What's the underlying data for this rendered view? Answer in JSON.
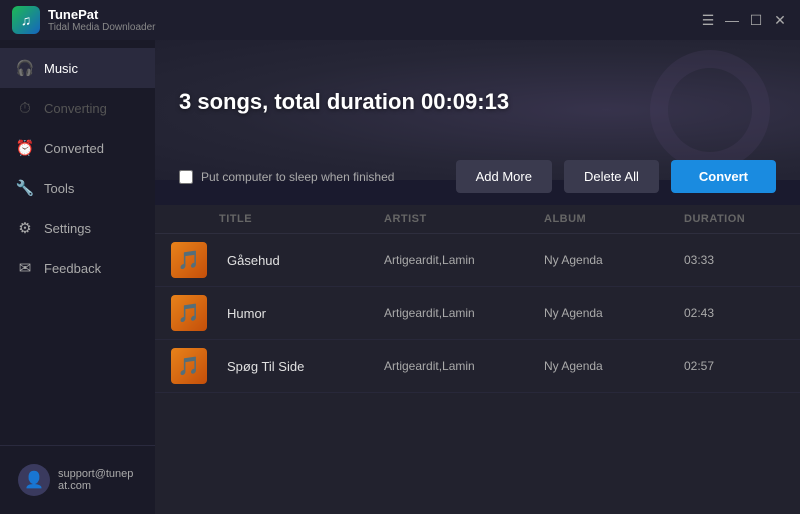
{
  "app": {
    "name": "TunePat",
    "subtitle": "Tidal Media Downloader",
    "logo_icon": "♫"
  },
  "titlebar": {
    "menu_icon": "☰",
    "minimize_icon": "—",
    "maximize_icon": "☐",
    "close_icon": "✕"
  },
  "sidebar": {
    "items": [
      {
        "id": "music",
        "label": "Music",
        "icon": "🎧",
        "active": true,
        "disabled": false
      },
      {
        "id": "converting",
        "label": "Converting",
        "icon": "⏱",
        "active": false,
        "disabled": true
      },
      {
        "id": "converted",
        "label": "Converted",
        "icon": "⏰",
        "active": false,
        "disabled": false
      },
      {
        "id": "tools",
        "label": "Tools",
        "icon": "🔧",
        "active": false,
        "disabled": false
      },
      {
        "id": "settings",
        "label": "Settings",
        "icon": "⚙",
        "active": false,
        "disabled": false
      },
      {
        "id": "feedback",
        "label": "Feedback",
        "icon": "✉",
        "active": false,
        "disabled": false
      }
    ],
    "account": {
      "email": "support@tunepat.com",
      "avatar_icon": "👤"
    }
  },
  "content": {
    "page_title": "3 songs, total duration 00:09:13",
    "sleep_checkbox_label": "Put computer to sleep when finished",
    "add_more_label": "Add More",
    "delete_all_label": "Delete All",
    "convert_label": "Convert",
    "table": {
      "columns": [
        "",
        "TITLE",
        "ARTIST",
        "ALBUM",
        "DURATION"
      ],
      "rows": [
        {
          "title": "Gåsehud",
          "artist": "Artigeardit,Lamin",
          "album": "Ny Agenda",
          "duration": "03:33",
          "thumb_icon": "♫"
        },
        {
          "title": "Humor",
          "artist": "Artigeardit,Lamin",
          "album": "Ny Agenda",
          "duration": "02:43",
          "thumb_icon": "♫"
        },
        {
          "title": "Spøg Til Side",
          "artist": "Artigeardit,Lamin",
          "album": "Ny Agenda",
          "duration": "02:57",
          "thumb_icon": "♫"
        }
      ]
    }
  }
}
